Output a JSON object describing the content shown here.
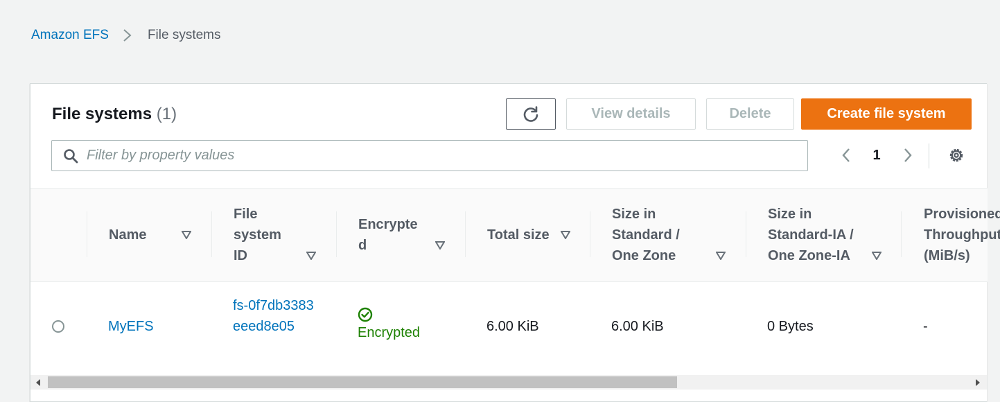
{
  "breadcrumb": {
    "root": "Amazon EFS",
    "current": "File systems"
  },
  "panel": {
    "title": "File systems",
    "count": "(1)",
    "buttons": {
      "refresh_icon": "refresh-icon",
      "view_details": "View details",
      "delete": "Delete",
      "create": "Create file system"
    },
    "filter": {
      "placeholder": "Filter by property values",
      "value": ""
    },
    "pagination": {
      "current_page": "1"
    }
  },
  "table": {
    "headers": [
      {
        "label": "Name"
      },
      {
        "label": "File system ID"
      },
      {
        "label": "Encrypted"
      },
      {
        "label": "Total size"
      },
      {
        "label": "Size in Standard / One Zone"
      },
      {
        "label": "Size in Standard-IA / One Zone-IA"
      },
      {
        "label": "Provisioned Throughput (MiB/s)"
      }
    ],
    "rows": [
      {
        "name": "MyEFS",
        "id": "fs-0f7db3383eeed8e05",
        "encrypted": "Encrypted",
        "total_size": "6.00 KiB",
        "size_standard": "6.00 KiB",
        "size_ia": "0 Bytes",
        "throughput": "-"
      }
    ]
  },
  "colors": {
    "accent": "#ec7211",
    "link": "#0073bb",
    "success": "#1d8102"
  }
}
